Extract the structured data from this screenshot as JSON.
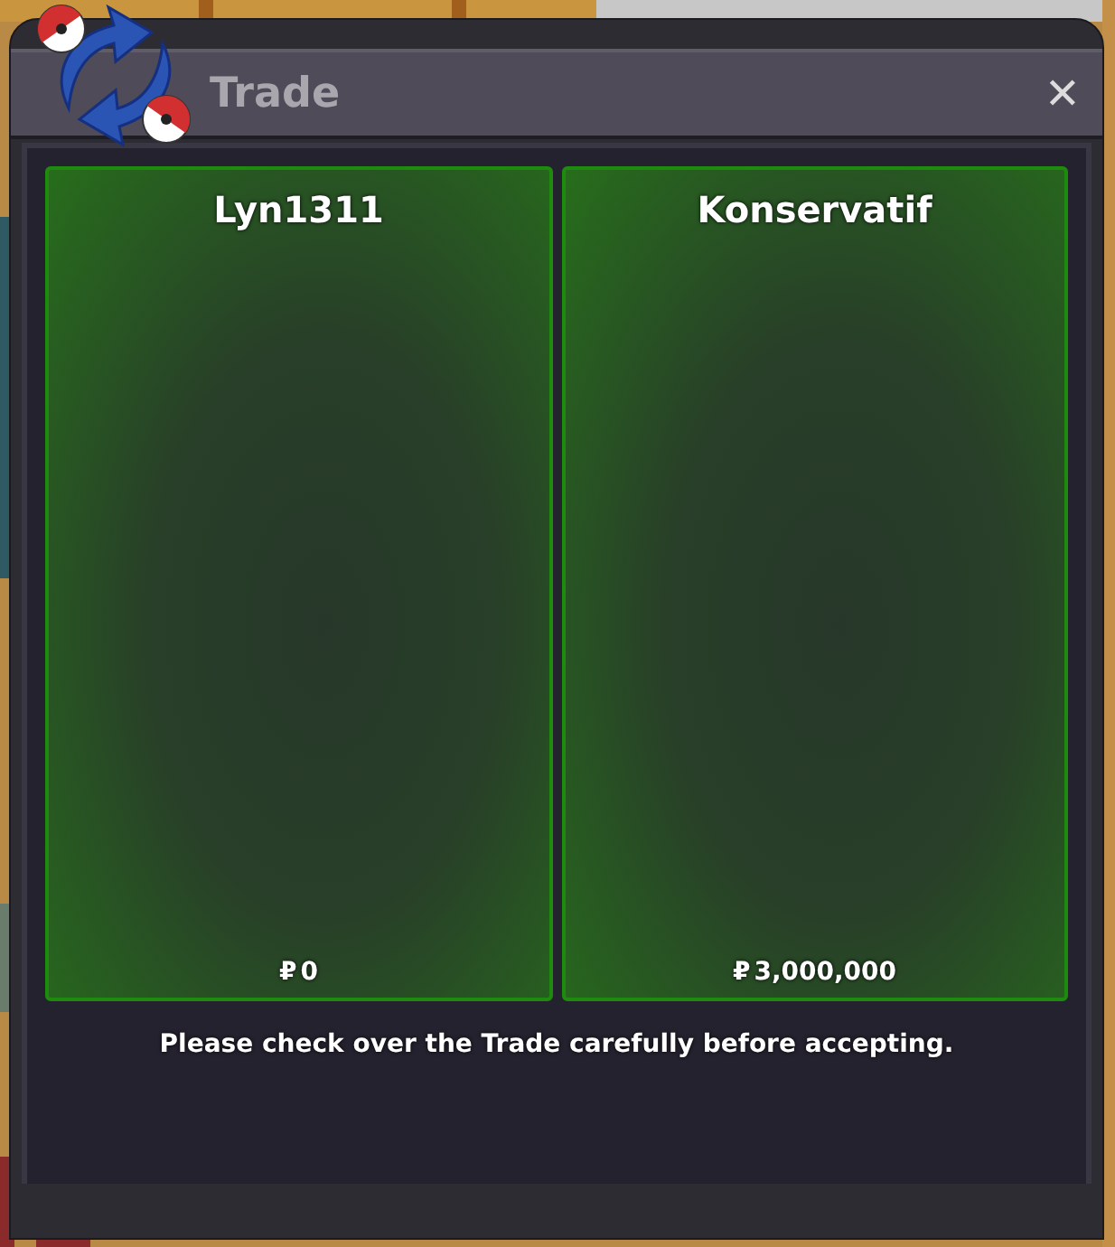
{
  "window": {
    "title": "Trade",
    "close": "✕"
  },
  "traders": [
    {
      "name": "Lyn1311",
      "currency": "₽",
      "amount": "0"
    },
    {
      "name": "Konservatif",
      "currency": "₽",
      "amount": "3,000,000"
    }
  ],
  "notice": "Please check over the Trade carefully before accepting."
}
